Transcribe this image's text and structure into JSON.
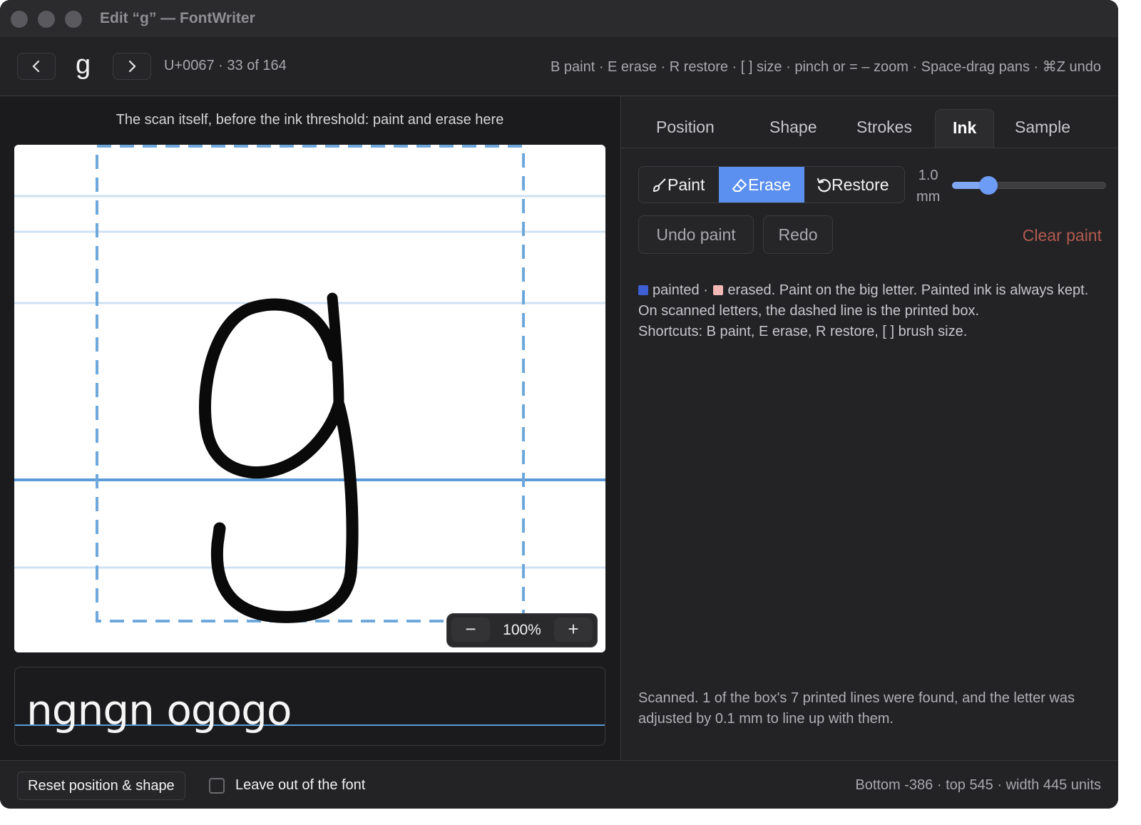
{
  "window": {
    "title": "Edit “g” — FontWriter"
  },
  "toolbar": {
    "prev_icon": "chevron-left",
    "next_icon": "chevron-right",
    "glyph": "g",
    "codepoint_info": "U+0067 · 33 of 164",
    "shortcuts": "B paint · E erase · R restore · [ ] size · pinch or = – zoom · Space-drag pans · ⌘Z undo"
  },
  "editor": {
    "scan_label": "The scan itself, before the ink threshold: paint and erase here",
    "zoom": {
      "minus": "−",
      "value": "100%",
      "plus": "+"
    },
    "sample_text": "ngngn ogogo"
  },
  "tabs": [
    {
      "label": "Position",
      "active": false
    },
    {
      "label": "Shape",
      "active": false
    },
    {
      "label": "Strokes",
      "active": false
    },
    {
      "label": "Ink",
      "active": true
    },
    {
      "label": "Sample",
      "active": false
    }
  ],
  "ink": {
    "modes": [
      {
        "label": "Paint",
        "icon": "brush-icon",
        "active": false
      },
      {
        "label": "Erase",
        "icon": "eraser-icon",
        "active": true
      },
      {
        "label": "Restore",
        "icon": "restore-icon",
        "active": false
      }
    ],
    "brush_value": "1.0",
    "brush_unit": "mm",
    "brush_fraction": 0.2,
    "undo_label": "Undo paint",
    "redo_label": "Redo",
    "clear_label": "Clear paint",
    "legend_painted": "painted",
    "legend_sep": "·",
    "legend_erased": "erased. Paint on the big letter. Painted ink is always kept. On scanned letters, the dashed line is the printed box.",
    "legend_shortcuts": "Shortcuts: B paint, E erase, R restore, [ ] brush size.",
    "painted_color": "#3d5fd6",
    "erased_color": "#f2b8b8",
    "scan_note": "Scanned. 1 of the box's 7 printed lines were found, and the letter was adjusted by 0.1 mm to line up with them."
  },
  "bottom": {
    "reset_label": "Reset position & shape",
    "leave_out_label": "Leave out of the font",
    "leave_out_checked": false,
    "metrics": "Bottom -386 · top 545 · width 445 units"
  },
  "colors": {
    "accent": "#5b8ff0",
    "guide_line": "#bcd6ee",
    "baseline": "#5a9bd8",
    "box_dash": "#6ea8dc",
    "danger": "#b35a4f"
  }
}
